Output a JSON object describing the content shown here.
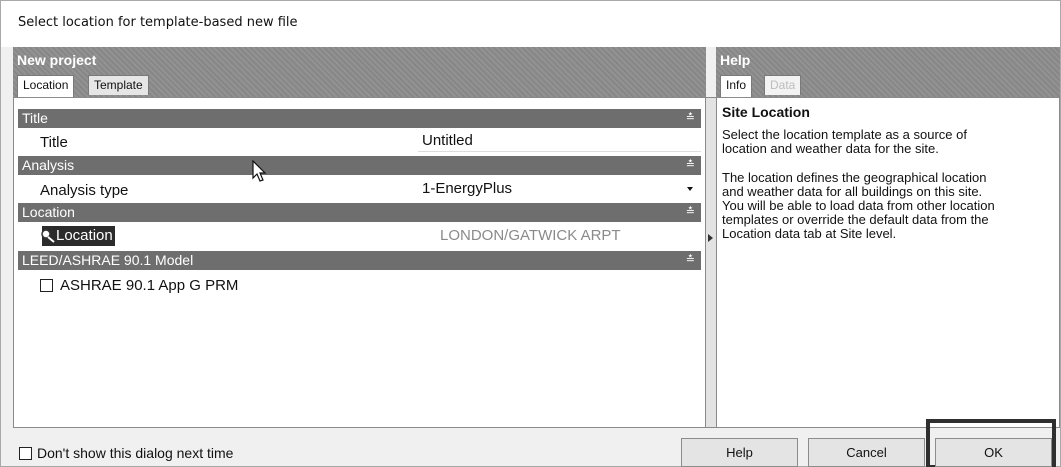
{
  "window": {
    "title": "Select location for template-based new file"
  },
  "left_pane": {
    "header": "New project",
    "tabs": [
      {
        "label": "Location",
        "active": true
      },
      {
        "label": "Template",
        "active": false
      }
    ],
    "sections": {
      "title": {
        "label": "Title",
        "row_label": "Title",
        "row_value": "Untitled"
      },
      "analysis": {
        "label": "Analysis",
        "row_label": "Analysis type",
        "row_value": "1-EnergyPlus"
      },
      "location": {
        "label": "Location",
        "row_label": "Location",
        "row_value": "LONDON/GATWICK ARPT"
      },
      "leed": {
        "label": "LEED/ASHRAE 90.1 Model",
        "checkbox_label": "ASHRAE 90.1 App G PRM",
        "checked": false
      }
    }
  },
  "right_pane": {
    "header": "Help",
    "tabs": [
      {
        "label": "Info",
        "active": true
      },
      {
        "label": "Data",
        "active": false,
        "disabled": true
      }
    ],
    "help_title": "Site Location",
    "help_paragraph_1": [
      "Select the location template as a source of",
      "location and weather data for the site."
    ],
    "help_paragraph_2": [
      "The location defines the geographical location",
      "and weather data for all buildings on this site.",
      "You will be able to load data from other location",
      "templates or override the default data from the",
      "Location data tab at Site level."
    ]
  },
  "footer": {
    "dont_show_label": "Don't show this dialog next time",
    "dont_show_checked": false,
    "help_button": "Help",
    "cancel_button": "Cancel",
    "ok_button": "OK"
  },
  "icons": {
    "section_expand": "double-chevron-icon",
    "location_pin": "pin-icon",
    "dropdown": "dropdown-arrow-icon",
    "pane_toggle": "triangle-right-icon",
    "mouse_pointer": "cursor-icon"
  }
}
